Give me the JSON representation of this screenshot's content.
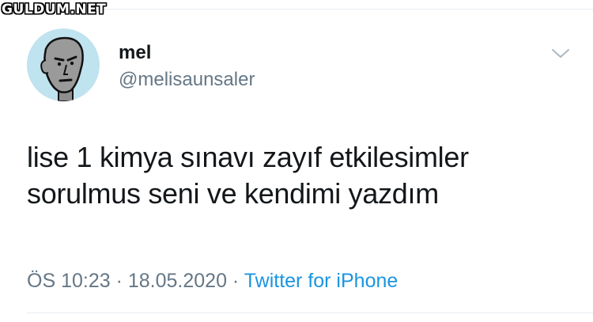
{
  "watermark": {
    "text": "GULDUM.NET"
  },
  "tweet": {
    "display_name": "mel",
    "handle": "@melisaunsaler",
    "text_lines": [
      "lise 1 kimya sınavı zayıf etkilesimler",
      "sorulmus seni ve kendimi yazdım"
    ],
    "time": "ÖS 10:23",
    "separator": " · ",
    "date": "18.05.2020",
    "source": "Twitter for iPhone"
  },
  "icons": {
    "avatar": "npc-face-avatar",
    "menu": "chevron-down-icon"
  },
  "colors": {
    "text": "#14171a",
    "secondary": "#657786",
    "link": "#1b95e0",
    "avatar_bg": "#bfe3ef"
  }
}
